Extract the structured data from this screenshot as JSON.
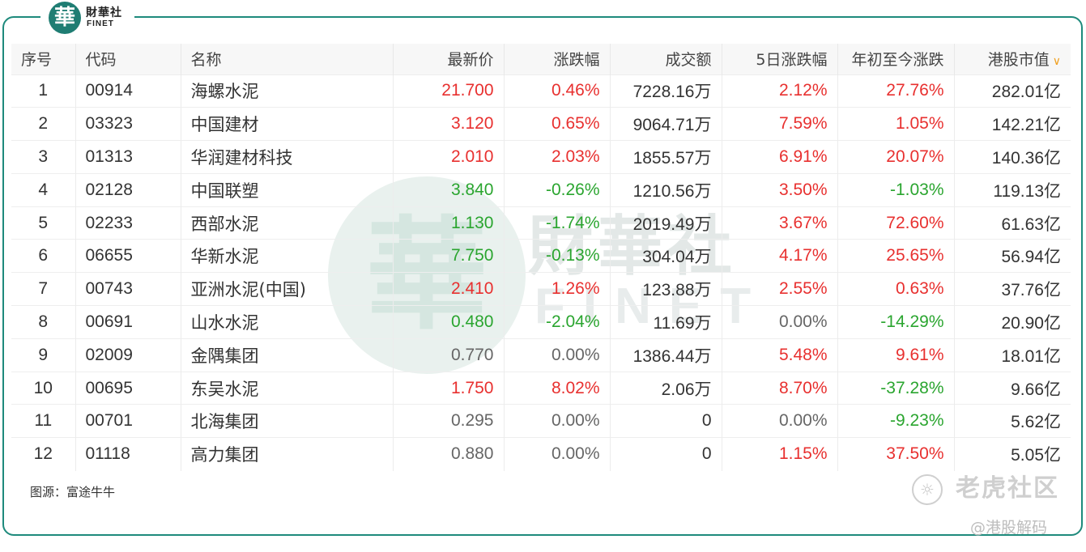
{
  "brand": {
    "seal_char": "華",
    "name_cn": "財華社",
    "name_en": "FINET"
  },
  "watermark": {
    "seal_char": "華",
    "name_cn": "財華社",
    "name_en": "FINET"
  },
  "table": {
    "headers": [
      "序号",
      "代码",
      "名称",
      "最新价",
      "涨跌幅",
      "成交额",
      "5日涨跌幅",
      "年初至今涨跌",
      "港股市值"
    ],
    "sorted_column": "港股市值",
    "rows": [
      {
        "no": "1",
        "code": "00914",
        "name": "海螺水泥",
        "price": "21.700",
        "chg": "0.46%",
        "turnover": "7228.16万",
        "chg5d": "2.12%",
        "ytd": "27.76%",
        "mcap": "282.01亿",
        "price_dir": "up",
        "chg_dir": "up",
        "chg5d_dir": "up",
        "ytd_dir": "up"
      },
      {
        "no": "2",
        "code": "03323",
        "name": "中国建材",
        "price": "3.120",
        "chg": "0.65%",
        "turnover": "9064.71万",
        "chg5d": "7.59%",
        "ytd": "1.05%",
        "mcap": "142.21亿",
        "price_dir": "up",
        "chg_dir": "up",
        "chg5d_dir": "up",
        "ytd_dir": "up"
      },
      {
        "no": "3",
        "code": "01313",
        "name": "华润建材科技",
        "price": "2.010",
        "chg": "2.03%",
        "turnover": "1855.57万",
        "chg5d": "6.91%",
        "ytd": "20.07%",
        "mcap": "140.36亿",
        "price_dir": "up",
        "chg_dir": "up",
        "chg5d_dir": "up",
        "ytd_dir": "up"
      },
      {
        "no": "4",
        "code": "02128",
        "name": "中国联塑",
        "price": "3.840",
        "chg": "-0.26%",
        "turnover": "1210.56万",
        "chg5d": "3.50%",
        "ytd": "-1.03%",
        "mcap": "119.13亿",
        "price_dir": "down",
        "chg_dir": "down",
        "chg5d_dir": "up",
        "ytd_dir": "down"
      },
      {
        "no": "5",
        "code": "02233",
        "name": "西部水泥",
        "price": "1.130",
        "chg": "-1.74%",
        "turnover": "2019.49万",
        "chg5d": "3.67%",
        "ytd": "72.60%",
        "mcap": "61.63亿",
        "price_dir": "down",
        "chg_dir": "down",
        "chg5d_dir": "up",
        "ytd_dir": "up"
      },
      {
        "no": "6",
        "code": "06655",
        "name": "华新水泥",
        "price": "7.750",
        "chg": "-0.13%",
        "turnover": "304.04万",
        "chg5d": "4.17%",
        "ytd": "25.65%",
        "mcap": "56.94亿",
        "price_dir": "down",
        "chg_dir": "down",
        "chg5d_dir": "up",
        "ytd_dir": "up"
      },
      {
        "no": "7",
        "code": "00743",
        "name": "亚洲水泥(中国)",
        "price": "2.410",
        "chg": "1.26%",
        "turnover": "123.88万",
        "chg5d": "2.55%",
        "ytd": "0.63%",
        "mcap": "37.76亿",
        "price_dir": "up",
        "chg_dir": "up",
        "chg5d_dir": "up",
        "ytd_dir": "up"
      },
      {
        "no": "8",
        "code": "00691",
        "name": "山水水泥",
        "price": "0.480",
        "chg": "-2.04%",
        "turnover": "11.69万",
        "chg5d": "0.00%",
        "ytd": "-14.29%",
        "mcap": "20.90亿",
        "price_dir": "down",
        "chg_dir": "down",
        "chg5d_dir": "flat",
        "ytd_dir": "down"
      },
      {
        "no": "9",
        "code": "02009",
        "name": "金隅集团",
        "price": "0.770",
        "chg": "0.00%",
        "turnover": "1386.44万",
        "chg5d": "5.48%",
        "ytd": "9.61%",
        "mcap": "18.01亿",
        "price_dir": "flat",
        "chg_dir": "flat",
        "chg5d_dir": "up",
        "ytd_dir": "up"
      },
      {
        "no": "10",
        "code": "00695",
        "name": "东吴水泥",
        "price": "1.750",
        "chg": "8.02%",
        "turnover": "2.06万",
        "chg5d": "8.70%",
        "ytd": "-37.28%",
        "mcap": "9.66亿",
        "price_dir": "up",
        "chg_dir": "up",
        "chg5d_dir": "up",
        "ytd_dir": "down"
      },
      {
        "no": "11",
        "code": "00701",
        "name": "北海集团",
        "price": "0.295",
        "chg": "0.00%",
        "turnover": "0",
        "chg5d": "0.00%",
        "ytd": "-9.23%",
        "mcap": "5.62亿",
        "price_dir": "flat",
        "chg_dir": "flat",
        "chg5d_dir": "flat",
        "ytd_dir": "down"
      },
      {
        "no": "12",
        "code": "01118",
        "name": "高力集团",
        "price": "0.880",
        "chg": "0.00%",
        "turnover": "0",
        "chg5d": "1.15%",
        "ytd": "37.50%",
        "mcap": "5.05亿",
        "price_dir": "flat",
        "chg_dir": "flat",
        "chg5d_dir": "up",
        "ytd_dir": "up"
      }
    ]
  },
  "source": "图源：富途牛牛",
  "footer": {
    "tiger_text": "老虎社区",
    "handle": "@港股解码"
  },
  "colors": {
    "up": "#e8302f",
    "down": "#2aa52f",
    "frame": "#1e8a7c",
    "sort_arrow": "#f0a020"
  }
}
